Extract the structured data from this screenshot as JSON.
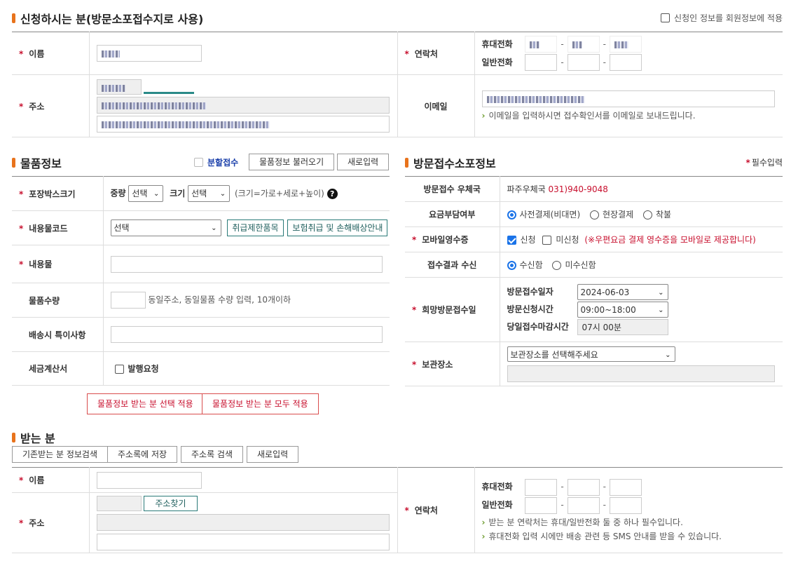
{
  "applicant": {
    "title": "신청하시는 분(방문소포접수지로 사용)",
    "apply_member_info": "신청인 정보를 회원정보에 적용",
    "name_label": "이름",
    "address_label": "주소",
    "contact_label": "연락처",
    "mobile_label": "휴대전화",
    "phone_label": "일반전화",
    "email_label": "이메일",
    "email_note": "이메일을 입력하시면 접수확인서를 이메일로 보내드립니다."
  },
  "item": {
    "title": "물품정보",
    "split_label": "분할접수",
    "load_button": "물품정보 불러오기",
    "new_button": "새로입력",
    "box_size_label": "포장박스크기",
    "weight_label": "중량",
    "weight_value": "선택",
    "size_label": "크기",
    "size_value": "선택",
    "size_hint": "(크기=가로+세로+높이)",
    "help_icon_text": "?",
    "content_code_label": "내용물코드",
    "content_code_value": "선택",
    "restricted_button": "취급제한품목",
    "insurance_button": "보험취급 및 손해배상안내",
    "content_label": "내용물",
    "quantity_label": "물품수량",
    "quantity_note": "동일주소, 동일물품 수량 입력, 10개이하",
    "special_label": "배송시 특이사항",
    "tax_label": "세금계산서",
    "tax_issue_label": "발행요청",
    "apply_selected_button": "물품정보 받는 분 선택 적용",
    "apply_all_button": "물품정보 받는 분 모두 적용"
  },
  "visit": {
    "title": "방문접수소포정보",
    "required_note": "필수입력",
    "office_label": "방문접수 우체국",
    "office_name": "파주우체국",
    "office_phone": "031)940-9048",
    "fee_label": "요금부담여부",
    "fee_options": [
      "사전결제(비대면)",
      "현장결제",
      "착불"
    ],
    "receipt_label": "모바일영수증",
    "receipt_apply": "신청",
    "receipt_no": "미신청",
    "receipt_note": "(※우편요금 결제 영수증을 모바일로 제공합니다)",
    "result_label": "접수결과 수신",
    "result_options": [
      "수신함",
      "미수신함"
    ],
    "wish_label": "희망방문접수일",
    "date_label": "방문접수일자",
    "date_value": "2024-06-03",
    "time_label": "방문신청시간",
    "time_value": "09:00~18:00",
    "deadline_label": "당일접수마감시간",
    "deadline_value": "07시 00분",
    "storage_label": "보관장소",
    "storage_value": "보관장소를 선택해주세요"
  },
  "receiver": {
    "title": "받는 분",
    "buttons": [
      "기존받는 분 정보검색",
      "주소록에 저장",
      "주소록 검색",
      "새로입력"
    ],
    "name_label": "이름",
    "address_label": "주소",
    "find_address_button": "주소찾기",
    "contact_label": "연락처",
    "mobile_label": "휴대전화",
    "phone_label": "일반전화",
    "note1": "받는 분 연락처는 휴대/일반전화 둘 중 하나 필수입니다.",
    "note2": "휴대전화 입력 시에만 배송 관련 등 SMS 안내를 받을 수 있습니다."
  },
  "colors": {
    "accent": "#e8731c",
    "required": "#c8102e",
    "teal": "#2a7a78",
    "checked": "#1a73e8"
  }
}
